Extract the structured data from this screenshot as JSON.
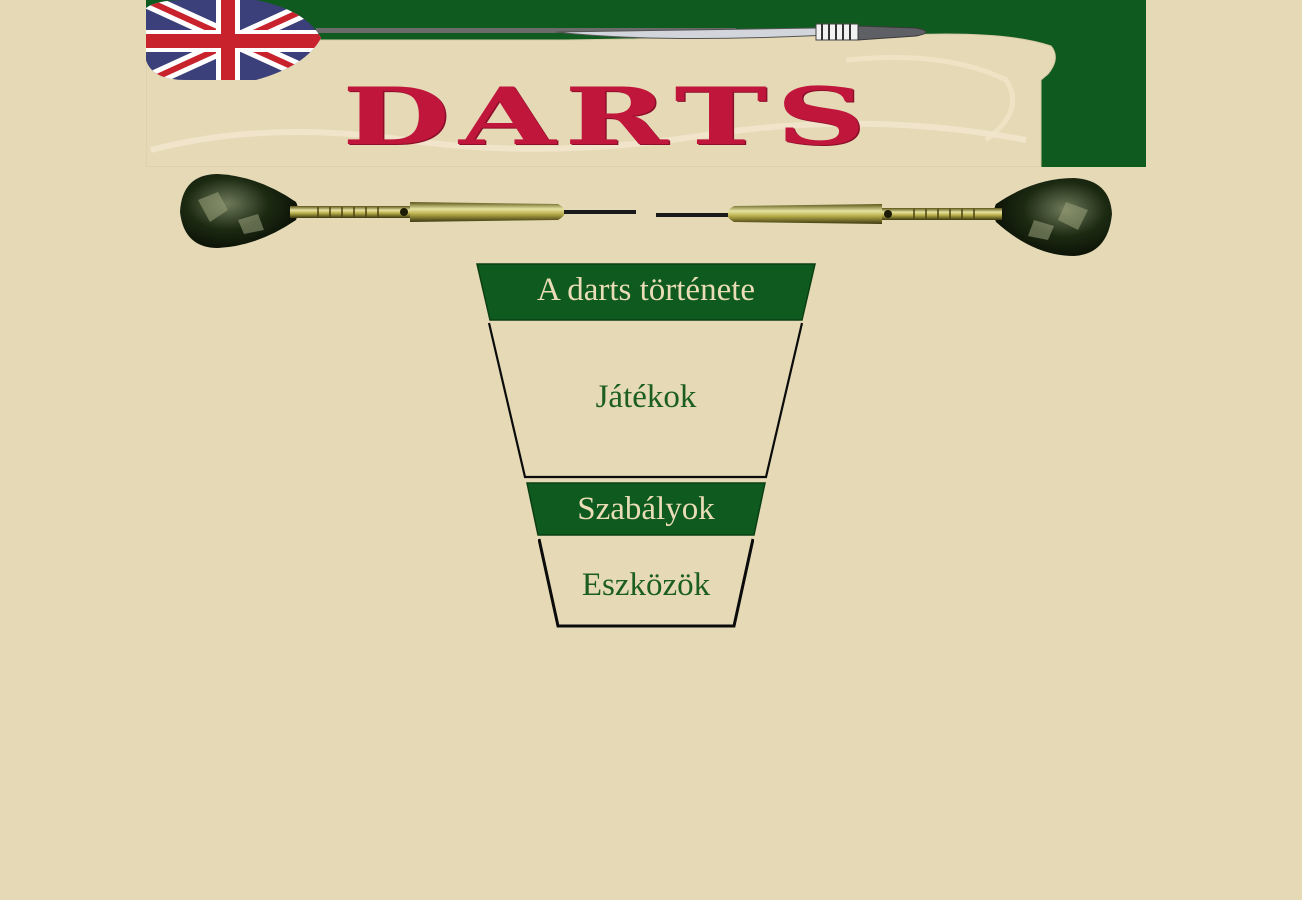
{
  "banner": {
    "logo_text": "DARTS",
    "logo_color": "#c0163c",
    "flag_icon": "union-jack-flag-icon",
    "green": "#0f5a1e"
  },
  "menu": {
    "items": [
      {
        "label": "A darts története",
        "style": "green"
      },
      {
        "label": "Játékok",
        "style": "beige"
      },
      {
        "label": "Szabályok",
        "style": "green"
      },
      {
        "label": "Eszközök",
        "style": "beige"
      }
    ]
  },
  "colors": {
    "background": "#e6d9b6",
    "menu_green": "#0f5a1e",
    "menu_text_light": "#e9dcb6",
    "menu_text_dark": "#1b5e20"
  }
}
